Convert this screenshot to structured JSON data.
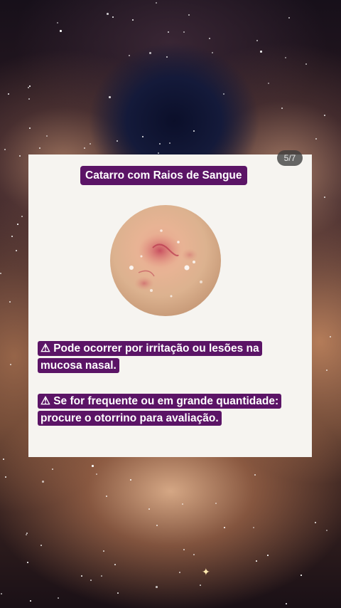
{
  "story": {
    "counter": "5/7",
    "title": "Catarro com Raios de Sangue",
    "notes": [
      "⚠ Pode ocorrer por irritação ou lesões na mucosa nasal.",
      "⚠ Se for frequente ou em grande quantidade: procure o otorrino para avaliação."
    ]
  },
  "icons": {
    "warning": "warning-icon",
    "sparkle": "sparkle-star-icon"
  },
  "colors": {
    "title_background": "#5b1466",
    "card_background": "#f6f4f0",
    "text": "#ffffff"
  }
}
